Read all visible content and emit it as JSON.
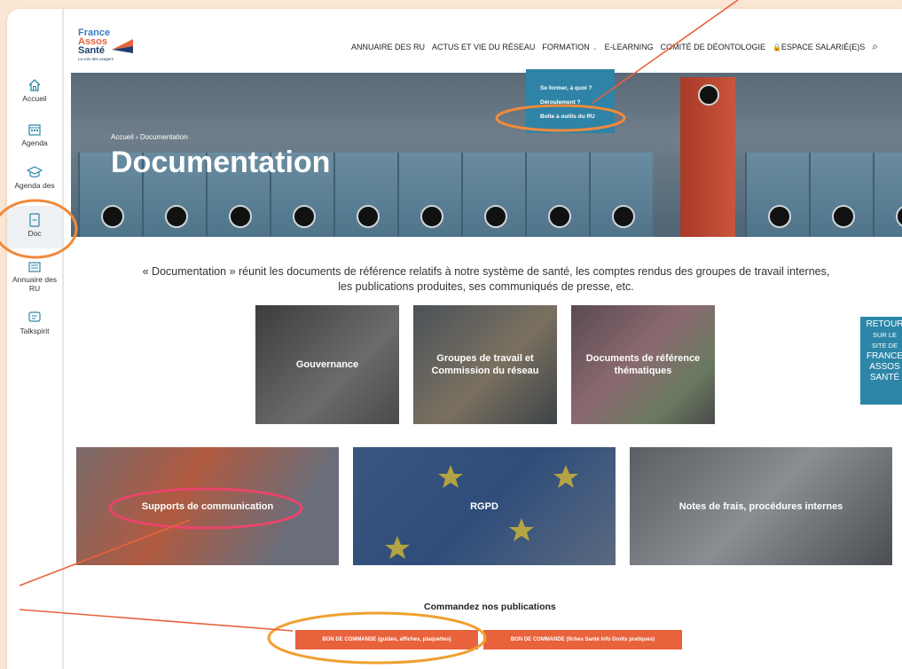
{
  "sidebar": {
    "items": [
      {
        "label": "Accueil",
        "icon": "home-icon"
      },
      {
        "label": "Agenda",
        "icon": "calendar-icon"
      },
      {
        "label": "Agenda des",
        "icon": "graduation-cap-icon"
      },
      {
        "label": "Doc",
        "icon": "document-icon"
      },
      {
        "label": "Annuaire des RU",
        "icon": "directory-icon"
      },
      {
        "label": "Talkspirit",
        "icon": "chat-icon"
      }
    ]
  },
  "logo": {
    "line1": "France",
    "line2": "Assos",
    "line3": "Santé",
    "tagline": "La voix des usagers"
  },
  "nav": {
    "items": [
      "ANNUAIRE DES RU",
      "ACTUS ET VIE DU RÉSEAU",
      "FORMATION",
      "E-LEARNING",
      "COMITÉ DE DÉONTOLOGIE",
      "ESPACE SALARIÉ(E)S"
    ],
    "chevron": "⌄",
    "lock": "🔒",
    "search": "⌕"
  },
  "dropdown": {
    "items": [
      "Se former, à quoi ?",
      "Déroulement ?",
      "Boîte à outils du RU"
    ]
  },
  "hero": {
    "breadcrumb": "Accueil › Documentation",
    "title": "Documentation"
  },
  "intro": "« Documentation » réunit les documents de référence relatifs à notre système de santé, les comptes rendus des groupes de travail internes, les publications produites, ses communiqués de presse, etc.",
  "tiles_row1": [
    "Gouvernance",
    "Groupes de travail et Commission du réseau",
    "Documents de référence thématiques"
  ],
  "tiles_row2": [
    "Supports de communication",
    "RGPD",
    "Notes de frais, procédures internes"
  ],
  "retour": {
    "line1": "RETOUR",
    "line2": "SUR LE",
    "line3": "SITE DE",
    "line4": "FRANCE",
    "line5": "ASSOS",
    "line6": "SANTÉ"
  },
  "commande": {
    "title": "Commandez nos publications",
    "button1": "BON DE COMMANDE (guides, affiches, plaquettes)",
    "button2": "BON DE COMMANDE (fiches Santé Info Droits pratiques)"
  },
  "colors": {
    "accent": "#e8623c",
    "teal": "#2d86a8",
    "background": "#fbe6d3"
  }
}
